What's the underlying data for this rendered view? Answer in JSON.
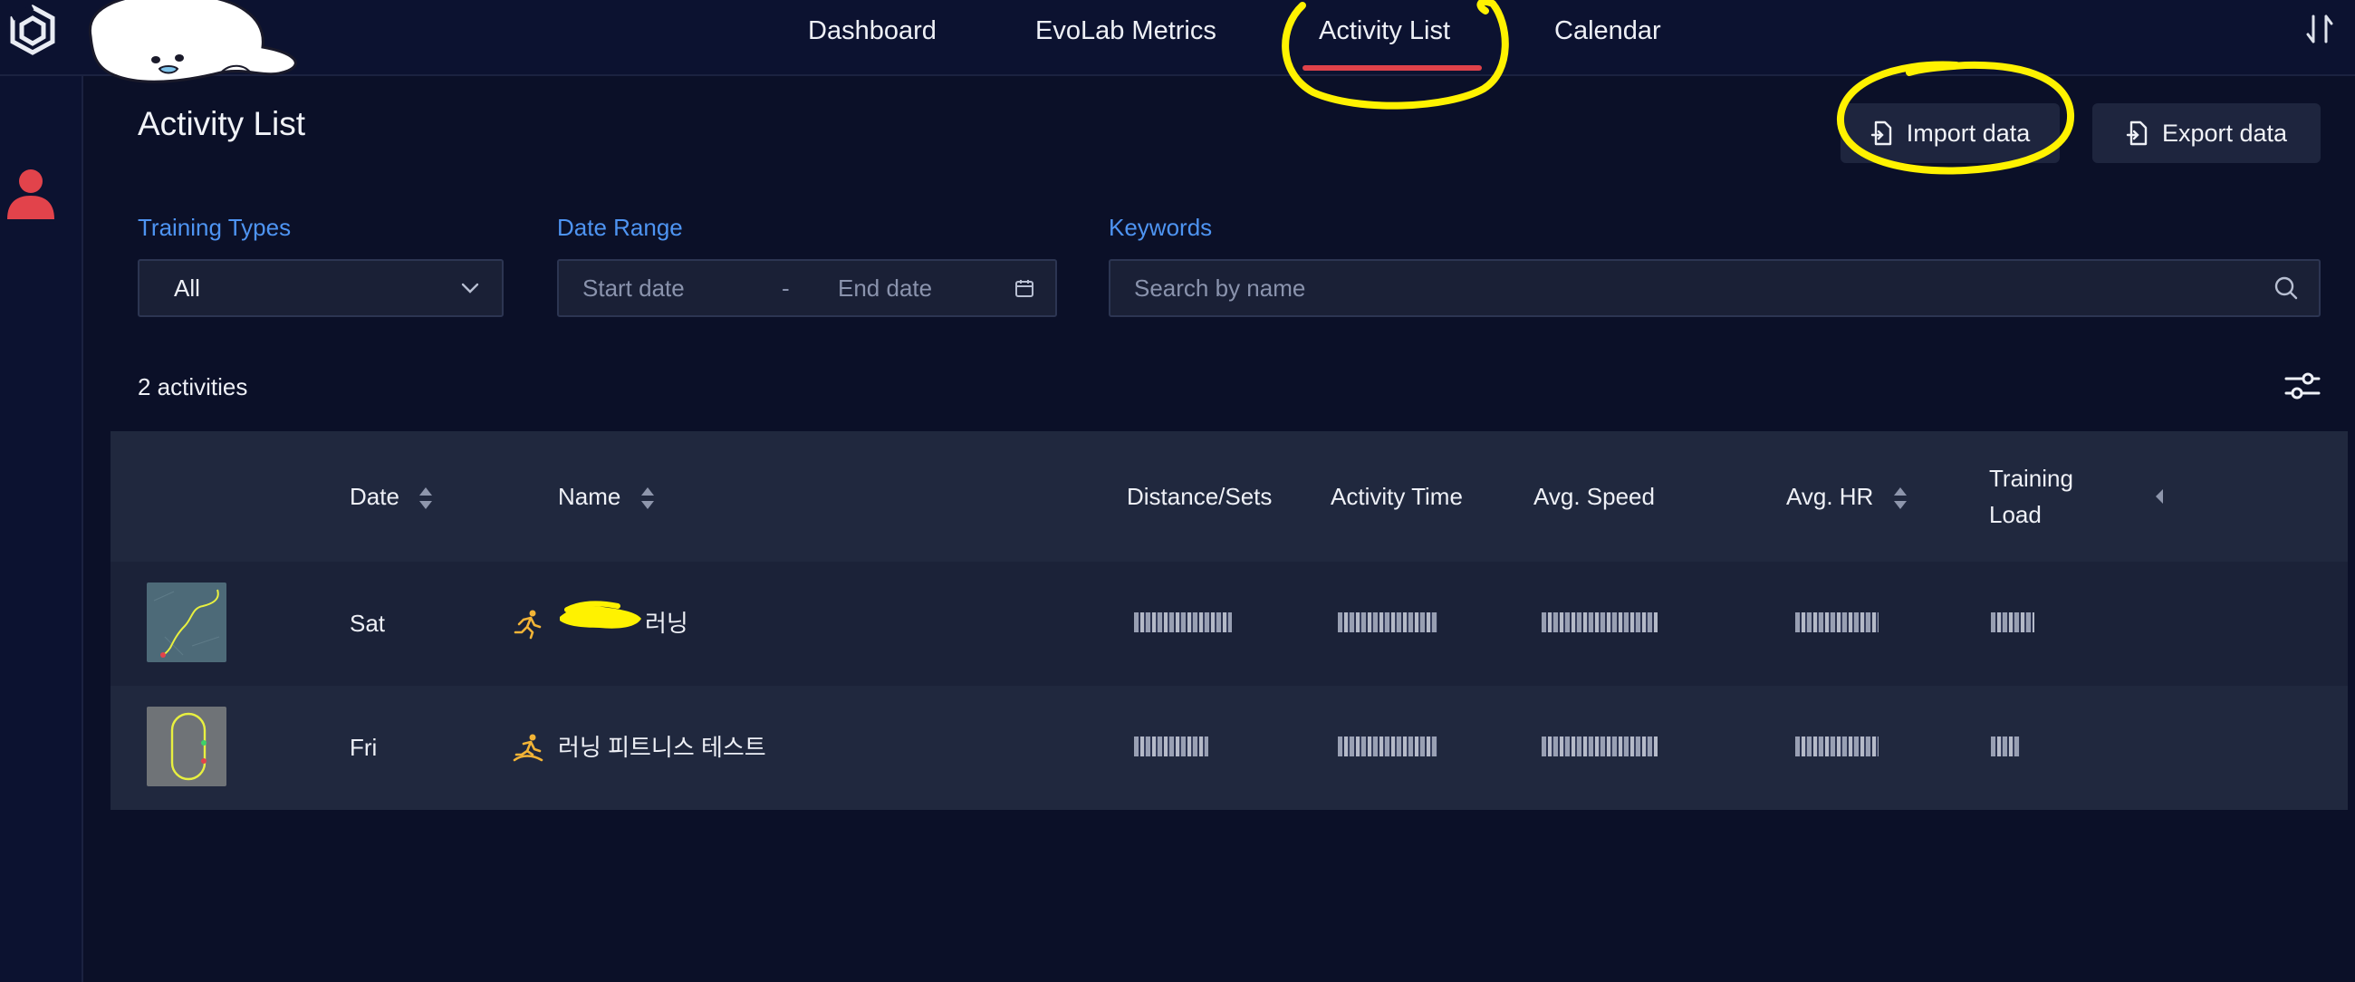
{
  "nav": {
    "tabs": [
      {
        "label": "Dashboard"
      },
      {
        "label": "EvoLab Metrics"
      },
      {
        "label": "Activity List"
      },
      {
        "label": "Calendar"
      }
    ],
    "active_tab": "Activity List"
  },
  "page": {
    "title": "Activity List",
    "import_label": "Import data",
    "export_label": "Export data"
  },
  "filters": {
    "training_types_label": "Training Types",
    "training_types_value": "All",
    "date_range_label": "Date Range",
    "start_placeholder": "Start date",
    "date_separator": "-",
    "end_placeholder": "End date",
    "keywords_label": "Keywords",
    "search_placeholder": "Search by name"
  },
  "summary": {
    "count_text": "2 activities"
  },
  "table": {
    "columns": [
      "Date",
      "Name",
      "Distance/Sets",
      "Activity Time",
      "Avg. Speed",
      "Avg. HR",
      "Training Load"
    ],
    "training_load_lines": [
      "Training",
      "Load"
    ],
    "rows": [
      {
        "day": "Sat",
        "name": "러닝",
        "type_icon": "running-icon"
      },
      {
        "day": "Fri",
        "name": "러닝 피트니스 테스트",
        "type_icon": "fitness-test-icon"
      }
    ]
  },
  "colors": {
    "accent_blue": "#4e94f2",
    "active_underline": "#e0424a",
    "activity_icon": "#f3b436",
    "annotation_yellow": "#fff200"
  }
}
